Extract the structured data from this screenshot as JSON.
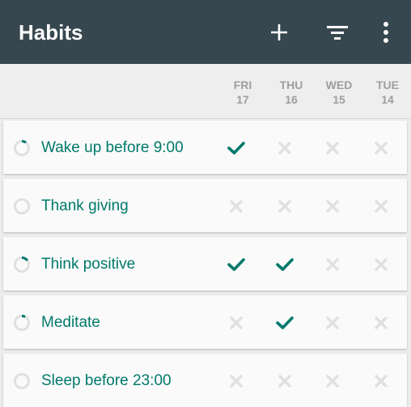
{
  "appbar": {
    "title": "Habits",
    "actions": [
      "add-icon",
      "filter-icon",
      "more-vert-icon"
    ]
  },
  "days": [
    {
      "dow": "FRI",
      "num": "17"
    },
    {
      "dow": "THU",
      "num": "16"
    },
    {
      "dow": "WED",
      "num": "15"
    },
    {
      "dow": "TUE",
      "num": "14"
    }
  ],
  "habits": [
    {
      "name": "Wake up before 9:00",
      "marks": [
        true,
        false,
        false,
        false
      ],
      "score": 0.1
    },
    {
      "name": "Thank giving",
      "marks": [
        false,
        false,
        false,
        false
      ],
      "score": 0
    },
    {
      "name": "Think positive",
      "marks": [
        true,
        true,
        false,
        false
      ],
      "score": 0.15
    },
    {
      "name": "Meditate",
      "marks": [
        false,
        true,
        false,
        false
      ],
      "score": 0.08
    },
    {
      "name": "Sleep before 23:00",
      "marks": [
        false,
        false,
        false,
        false
      ],
      "score": 0
    }
  ],
  "colors": {
    "appbar": "#37474f",
    "accent": "#00796b",
    "inactive": "#e0e0e0"
  }
}
